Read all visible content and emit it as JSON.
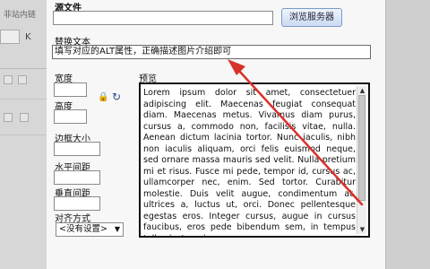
{
  "background": {
    "fragment_top": "非站内链",
    "fragment_k": "K"
  },
  "dialog": {
    "source_label": "源文件",
    "browse_button": "浏览服务器",
    "alt_label": "替换文本",
    "alt_value": "填写对应的ALT属性，正确描述图片介绍即可",
    "width_label": "宽度",
    "height_label": "高度",
    "border_label": "边框大小",
    "hspace_label": "水平间距",
    "vspace_label": "垂直间距",
    "align_label": "对齐方式",
    "align_selected": "<没有设置>",
    "preview_label": "预览",
    "preview_text": "Lorem ipsum dolor sit amet, consectetuer adipiscing elit. Maecenas feugiat consequat diam. Maecenas metus. Vivamus diam purus, cursus a, commodo non, facilisis vitae, nulla. Aenean dictum lacinia tortor. Nunc iaculis, nibh non iaculis aliquam, orci felis euismod neque, sed ornare massa mauris sed velit. Nulla pretium mi et risus. Fusce mi pede, tempor id, cursus ac, ullamcorper nec, enim. Sed tortor. Curabitur molestie. Duis velit augue, condimentum at, ultrices a, luctus ut, orci. Donec pellentesque egestas eros. Integer cursus, augue in cursus faucibus, eros pede bibendum sem, in tempus tellus justo quis"
  },
  "icons": {
    "lock": "lock-icon",
    "reset": "reset-size-icon"
  },
  "colors": {
    "annotation_arrow": "#d9302a",
    "button_border": "#7a9cc8"
  }
}
